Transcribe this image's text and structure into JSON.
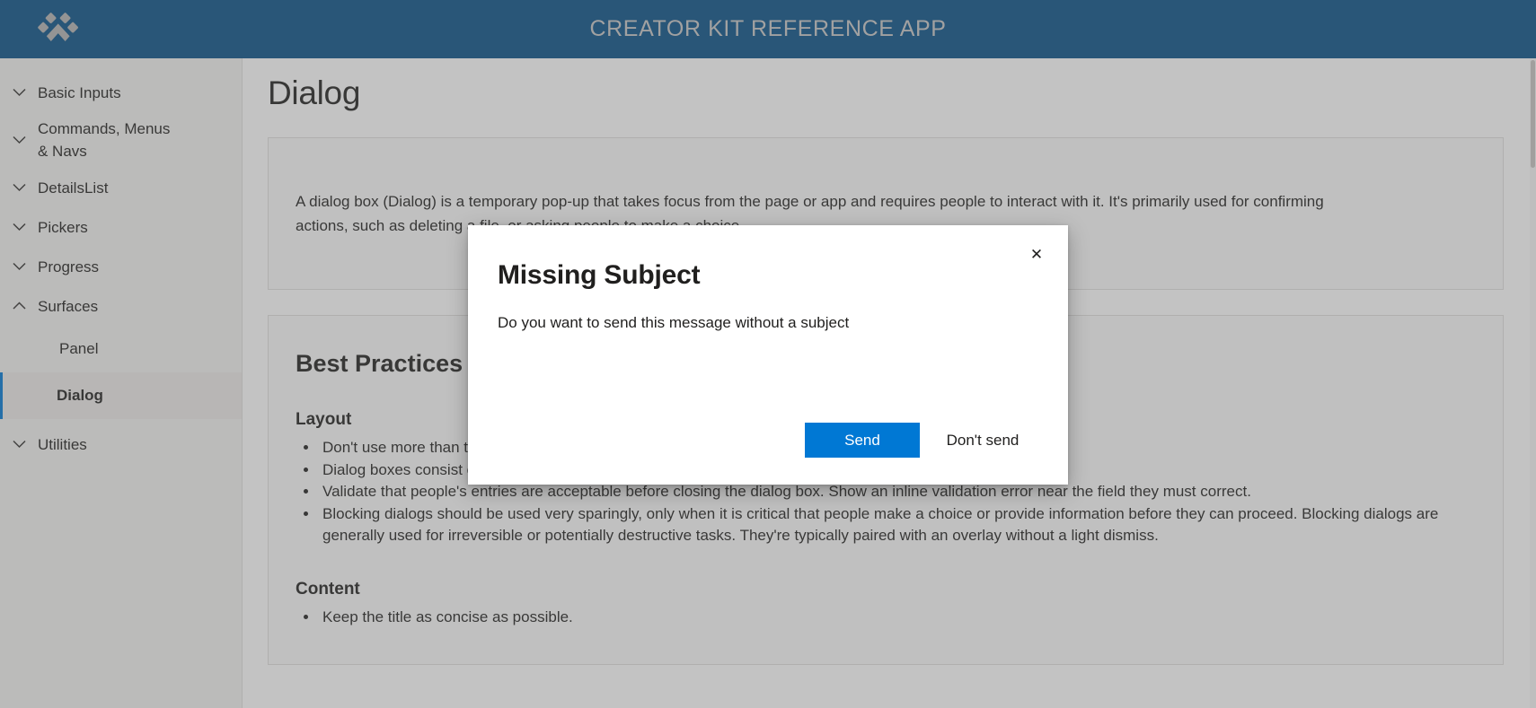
{
  "header": {
    "title": "CREATOR KIT REFERENCE APP",
    "logo_icon": "paw-print-icon",
    "brand_color": "#084f86",
    "title_color": "#c9c9c9"
  },
  "sidebar": {
    "groups": [
      {
        "label": "Basic Inputs",
        "expanded": false,
        "icon": "chevron-down-icon"
      },
      {
        "label": "Commands, Menus & Navs",
        "expanded": false,
        "icon": "chevron-down-icon"
      },
      {
        "label": "DetailsList",
        "expanded": false,
        "icon": "chevron-down-icon"
      },
      {
        "label": "Pickers",
        "expanded": false,
        "icon": "chevron-down-icon"
      },
      {
        "label": "Progress",
        "expanded": false,
        "icon": "chevron-down-icon"
      },
      {
        "label": "Surfaces",
        "expanded": true,
        "icon": "chevron-up-icon"
      },
      {
        "label": "Utilities",
        "expanded": false,
        "icon": "chevron-down-icon"
      }
    ],
    "surfaces_children": [
      {
        "label": "Panel",
        "selected": false
      },
      {
        "label": "Dialog",
        "selected": true
      }
    ],
    "selected_accent": "#0078d4"
  },
  "main": {
    "page_title": "Dialog",
    "intro": "A dialog box (Dialog) is a temporary pop-up that takes focus from the page or app and requires people to interact with it. It's primarily used for confirming actions, such as deleting a file, or asking people to make a choice.",
    "best_practices_heading": "Best Practices",
    "sections": [
      {
        "heading": "Layout",
        "bullets": [
          "Don't use more than three buttons.",
          "Dialog boxes consist of a header, body, and footer.",
          "Validate that people's entries are acceptable before closing the dialog box. Show an inline validation error near the field they must correct.",
          "Blocking dialogs should be used very sparingly, only when it is critical that people make a choice or provide information before they can proceed. Blocking dialogs are generally used for irreversible or potentially destructive tasks. They're typically paired with an overlay without a light dismiss."
        ]
      },
      {
        "heading": "Content",
        "bullets": [
          "Keep the title as concise as possible."
        ]
      }
    ]
  },
  "dialog": {
    "title": "Missing Subject",
    "subtext": "Do you want to send this message without a subject",
    "close_icon": "close-icon",
    "close_glyph": "✕",
    "primary_button": "Send",
    "secondary_button": "Don't send",
    "primary_color": "#0078d4"
  },
  "scrollbar": {
    "visible": true
  }
}
